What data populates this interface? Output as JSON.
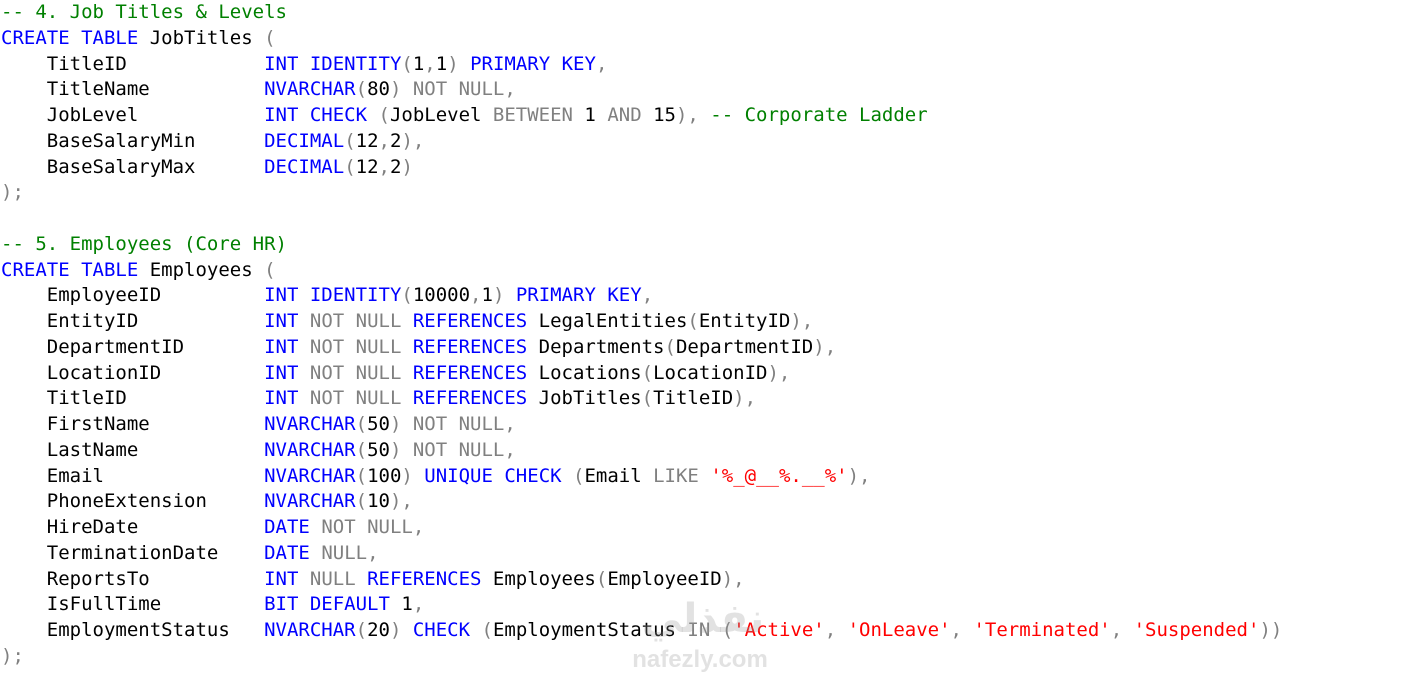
{
  "watermark": {
    "logo": "نفذلي",
    "text": "nafezly.com"
  },
  "lines": [
    {
      "tokens": [
        {
          "t": "-- 4. Job Titles & Levels",
          "c": "cm"
        }
      ]
    },
    {
      "tokens": [
        {
          "t": "CREATE TABLE",
          "c": "kw"
        },
        {
          "t": " JobTitles ",
          "c": "id"
        },
        {
          "t": "(",
          "c": "gr"
        }
      ]
    },
    {
      "tokens": [
        {
          "t": "    TitleID            ",
          "c": "id"
        },
        {
          "t": "INT IDENTITY",
          "c": "kw"
        },
        {
          "t": "(",
          "c": "gr"
        },
        {
          "t": "1",
          "c": "id"
        },
        {
          "t": ",",
          "c": "gr"
        },
        {
          "t": "1",
          "c": "id"
        },
        {
          "t": ")",
          "c": "gr"
        },
        {
          "t": " PRIMARY KEY",
          "c": "kw"
        },
        {
          "t": ",",
          "c": "gr"
        }
      ]
    },
    {
      "tokens": [
        {
          "t": "    TitleName          ",
          "c": "id"
        },
        {
          "t": "NVARCHAR",
          "c": "kw"
        },
        {
          "t": "(",
          "c": "gr"
        },
        {
          "t": "80",
          "c": "id"
        },
        {
          "t": ") NOT NULL,",
          "c": "gr"
        }
      ]
    },
    {
      "tokens": [
        {
          "t": "    JobLevel           ",
          "c": "id"
        },
        {
          "t": "INT CHECK ",
          "c": "kw"
        },
        {
          "t": "(",
          "c": "gr"
        },
        {
          "t": "JobLevel ",
          "c": "id"
        },
        {
          "t": "BETWEEN ",
          "c": "gr"
        },
        {
          "t": "1 ",
          "c": "id"
        },
        {
          "t": "AND ",
          "c": "gr"
        },
        {
          "t": "15",
          "c": "id"
        },
        {
          "t": "),",
          "c": "gr"
        },
        {
          "t": " -- Corporate Ladder",
          "c": "cm"
        }
      ]
    },
    {
      "tokens": [
        {
          "t": "    BaseSalaryMin      ",
          "c": "id"
        },
        {
          "t": "DECIMAL",
          "c": "kw"
        },
        {
          "t": "(",
          "c": "gr"
        },
        {
          "t": "12",
          "c": "id"
        },
        {
          "t": ",",
          "c": "gr"
        },
        {
          "t": "2",
          "c": "id"
        },
        {
          "t": "),",
          "c": "gr"
        }
      ]
    },
    {
      "tokens": [
        {
          "t": "    BaseSalaryMax      ",
          "c": "id"
        },
        {
          "t": "DECIMAL",
          "c": "kw"
        },
        {
          "t": "(",
          "c": "gr"
        },
        {
          "t": "12",
          "c": "id"
        },
        {
          "t": ",",
          "c": "gr"
        },
        {
          "t": "2",
          "c": "id"
        },
        {
          "t": ")",
          "c": "gr"
        }
      ]
    },
    {
      "tokens": [
        {
          "t": ");",
          "c": "gr"
        }
      ]
    },
    {
      "tokens": []
    },
    {
      "tokens": [
        {
          "t": "-- 5. Employees (Core HR)",
          "c": "cm"
        }
      ]
    },
    {
      "tokens": [
        {
          "t": "CREATE TABLE",
          "c": "kw"
        },
        {
          "t": " Employees ",
          "c": "id"
        },
        {
          "t": "(",
          "c": "gr"
        }
      ]
    },
    {
      "tokens": [
        {
          "t": "    EmployeeID         ",
          "c": "id"
        },
        {
          "t": "INT IDENTITY",
          "c": "kw"
        },
        {
          "t": "(",
          "c": "gr"
        },
        {
          "t": "10000",
          "c": "id"
        },
        {
          "t": ",",
          "c": "gr"
        },
        {
          "t": "1",
          "c": "id"
        },
        {
          "t": ")",
          "c": "gr"
        },
        {
          "t": " PRIMARY KEY",
          "c": "kw"
        },
        {
          "t": ",",
          "c": "gr"
        }
      ]
    },
    {
      "tokens": [
        {
          "t": "    EntityID           ",
          "c": "id"
        },
        {
          "t": "INT ",
          "c": "kw"
        },
        {
          "t": "NOT NULL ",
          "c": "gr"
        },
        {
          "t": "REFERENCES ",
          "c": "kw"
        },
        {
          "t": "LegalEntities",
          "c": "id"
        },
        {
          "t": "(",
          "c": "gr"
        },
        {
          "t": "EntityID",
          "c": "id"
        },
        {
          "t": "),",
          "c": "gr"
        }
      ]
    },
    {
      "tokens": [
        {
          "t": "    DepartmentID       ",
          "c": "id"
        },
        {
          "t": "INT ",
          "c": "kw"
        },
        {
          "t": "NOT NULL ",
          "c": "gr"
        },
        {
          "t": "REFERENCES ",
          "c": "kw"
        },
        {
          "t": "Departments",
          "c": "id"
        },
        {
          "t": "(",
          "c": "gr"
        },
        {
          "t": "DepartmentID",
          "c": "id"
        },
        {
          "t": "),",
          "c": "gr"
        }
      ]
    },
    {
      "tokens": [
        {
          "t": "    LocationID         ",
          "c": "id"
        },
        {
          "t": "INT ",
          "c": "kw"
        },
        {
          "t": "NOT NULL ",
          "c": "gr"
        },
        {
          "t": "REFERENCES ",
          "c": "kw"
        },
        {
          "t": "Locations",
          "c": "id"
        },
        {
          "t": "(",
          "c": "gr"
        },
        {
          "t": "LocationID",
          "c": "id"
        },
        {
          "t": "),",
          "c": "gr"
        }
      ]
    },
    {
      "tokens": [
        {
          "t": "    TitleID            ",
          "c": "id"
        },
        {
          "t": "INT ",
          "c": "kw"
        },
        {
          "t": "NOT NULL ",
          "c": "gr"
        },
        {
          "t": "REFERENCES ",
          "c": "kw"
        },
        {
          "t": "JobTitles",
          "c": "id"
        },
        {
          "t": "(",
          "c": "gr"
        },
        {
          "t": "TitleID",
          "c": "id"
        },
        {
          "t": "),",
          "c": "gr"
        }
      ]
    },
    {
      "tokens": [
        {
          "t": "    FirstName          ",
          "c": "id"
        },
        {
          "t": "NVARCHAR",
          "c": "kw"
        },
        {
          "t": "(",
          "c": "gr"
        },
        {
          "t": "50",
          "c": "id"
        },
        {
          "t": ") NOT NULL,",
          "c": "gr"
        }
      ]
    },
    {
      "tokens": [
        {
          "t": "    LastName           ",
          "c": "id"
        },
        {
          "t": "NVARCHAR",
          "c": "kw"
        },
        {
          "t": "(",
          "c": "gr"
        },
        {
          "t": "50",
          "c": "id"
        },
        {
          "t": ") NOT NULL,",
          "c": "gr"
        }
      ]
    },
    {
      "tokens": [
        {
          "t": "    Email              ",
          "c": "id"
        },
        {
          "t": "NVARCHAR",
          "c": "kw"
        },
        {
          "t": "(",
          "c": "gr"
        },
        {
          "t": "100",
          "c": "id"
        },
        {
          "t": ")",
          "c": "gr"
        },
        {
          "t": " UNIQUE CHECK ",
          "c": "kw"
        },
        {
          "t": "(",
          "c": "gr"
        },
        {
          "t": "Email ",
          "c": "id"
        },
        {
          "t": "LIKE ",
          "c": "gr"
        },
        {
          "t": "'%_@__%.__%'",
          "c": "st"
        },
        {
          "t": "),",
          "c": "gr"
        }
      ]
    },
    {
      "tokens": [
        {
          "t": "    PhoneExtension     ",
          "c": "id"
        },
        {
          "t": "NVARCHAR",
          "c": "kw"
        },
        {
          "t": "(",
          "c": "gr"
        },
        {
          "t": "10",
          "c": "id"
        },
        {
          "t": "),",
          "c": "gr"
        }
      ]
    },
    {
      "tokens": [
        {
          "t": "    HireDate           ",
          "c": "id"
        },
        {
          "t": "DATE ",
          "c": "kw"
        },
        {
          "t": "NOT NULL,",
          "c": "gr"
        }
      ]
    },
    {
      "tokens": [
        {
          "t": "    TerminationDate    ",
          "c": "id"
        },
        {
          "t": "DATE ",
          "c": "kw"
        },
        {
          "t": "NULL,",
          "c": "gr"
        }
      ]
    },
    {
      "tokens": [
        {
          "t": "    ReportsTo          ",
          "c": "id"
        },
        {
          "t": "INT ",
          "c": "kw"
        },
        {
          "t": "NULL ",
          "c": "gr"
        },
        {
          "t": "REFERENCES ",
          "c": "kw"
        },
        {
          "t": "Employees",
          "c": "id"
        },
        {
          "t": "(",
          "c": "gr"
        },
        {
          "t": "EmployeeID",
          "c": "id"
        },
        {
          "t": "),",
          "c": "gr"
        }
      ]
    },
    {
      "tokens": [
        {
          "t": "    IsFullTime         ",
          "c": "id"
        },
        {
          "t": "BIT DEFAULT ",
          "c": "kw"
        },
        {
          "t": "1",
          "c": "id"
        },
        {
          "t": ",",
          "c": "gr"
        }
      ]
    },
    {
      "tokens": [
        {
          "t": "    EmploymentStatus   ",
          "c": "id"
        },
        {
          "t": "NVARCHAR",
          "c": "kw"
        },
        {
          "t": "(",
          "c": "gr"
        },
        {
          "t": "20",
          "c": "id"
        },
        {
          "t": ")",
          "c": "gr"
        },
        {
          "t": " CHECK ",
          "c": "kw"
        },
        {
          "t": "(",
          "c": "gr"
        },
        {
          "t": "EmploymentStatus ",
          "c": "id"
        },
        {
          "t": "IN (",
          "c": "gr"
        },
        {
          "t": "'Active'",
          "c": "st"
        },
        {
          "t": ", ",
          "c": "gr"
        },
        {
          "t": "'OnLeave'",
          "c": "st"
        },
        {
          "t": ", ",
          "c": "gr"
        },
        {
          "t": "'Terminated'",
          "c": "st"
        },
        {
          "t": ", ",
          "c": "gr"
        },
        {
          "t": "'Suspended'",
          "c": "st"
        },
        {
          "t": "))",
          "c": "gr"
        }
      ]
    },
    {
      "tokens": [
        {
          "t": ");",
          "c": "gr"
        }
      ]
    }
  ]
}
